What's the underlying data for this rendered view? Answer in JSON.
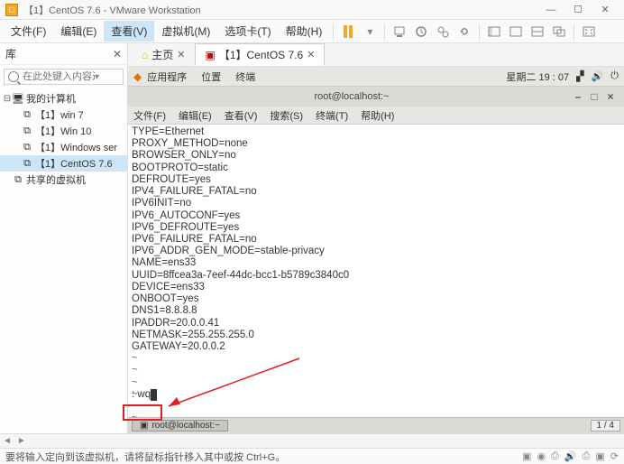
{
  "window": {
    "title": "【1】CentOS 7.6 - VMware Workstation"
  },
  "menu": {
    "file": "文件(F)",
    "edit": "编辑(E)",
    "view": "查看(V)",
    "vm": "虚拟机(M)",
    "tabs": "选项卡(T)",
    "help": "帮助(H)"
  },
  "sidebar": {
    "title": "库",
    "search_placeholder": "在此处键入内容进...",
    "root": "我的计算机",
    "items": [
      {
        "label": "【1】win 7"
      },
      {
        "label": "【1】Win 10"
      },
      {
        "label": "【1】Windows ser"
      },
      {
        "label": "【1】CentOS 7.6"
      }
    ],
    "shared": "共享的虚拟机"
  },
  "tabs": {
    "home": "主页",
    "vm": "【1】CentOS 7.6"
  },
  "gnome": {
    "apps": "应用程序",
    "places": "位置",
    "terminal": "终端",
    "clock": "星期二 19 : 07"
  },
  "terminal": {
    "title": "root@localhost:~",
    "menu": {
      "file": "文件(F)",
      "edit": "编辑(E)",
      "view": "查看(V)",
      "search": "搜索(S)",
      "term": "终端(T)",
      "help": "帮助(H)"
    },
    "lines": [
      "TYPE=Ethernet",
      "PROXY_METHOD=none",
      "BROWSER_ONLY=no",
      "BOOTPROTO=static",
      "DEFROUTE=yes",
      "IPV4_FAILURE_FATAL=no",
      "IPV6INIT=no",
      "IPV6_AUTOCONF=yes",
      "IPV6_DEFROUTE=yes",
      "IPV6_FAILURE_FATAL=no",
      "IPV6_ADDR_GEN_MODE=stable-privacy",
      "NAME=ens33",
      "UUID=8ffcea3a-7eef-44dc-bcc1-b5789c3840c0",
      "DEVICE=ens33",
      "ONBOOT=yes",
      "DNS1=8.8.8.8",
      "IPADDR=20.0.0.41",
      "NETMASK=255.255.255.0",
      "GATEWAY=20.0.0.2"
    ],
    "vim_cmd": ": wq",
    "task_label": "root@localhost:~",
    "pager": "1 / 4"
  },
  "status": {
    "text": "要将输入定向到该虚拟机，请将鼠标指针移入其中或按 Ctrl+G。"
  }
}
